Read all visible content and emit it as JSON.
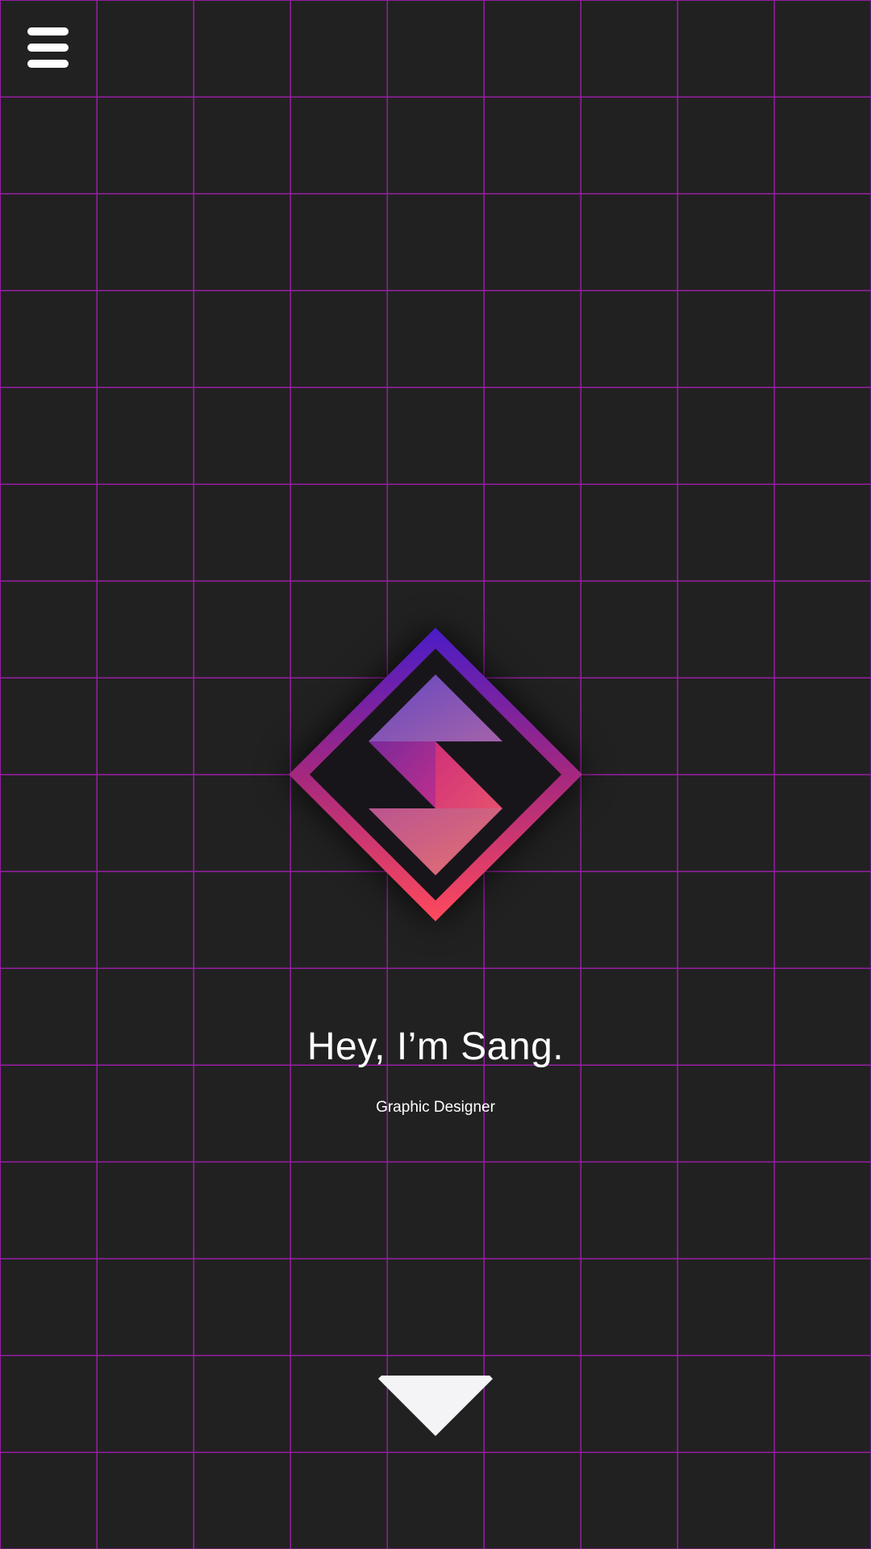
{
  "header": {
    "menu_icon": "hamburger-menu-icon"
  },
  "hero": {
    "logo_icon": "diamond-s-monogram-icon",
    "headline": "Hey, I’m Sang.",
    "subtitle": "Graphic Designer",
    "scroll_icon": "triangle-down-icon"
  },
  "colors": {
    "background": "#222122",
    "grid_lines": "#9c1ea8",
    "logo_gradient_top": "#4a1cc8",
    "logo_gradient_bottom": "#ff4a5c",
    "text": "#ffffff",
    "scroll_arrow": "#f4f4f7"
  }
}
